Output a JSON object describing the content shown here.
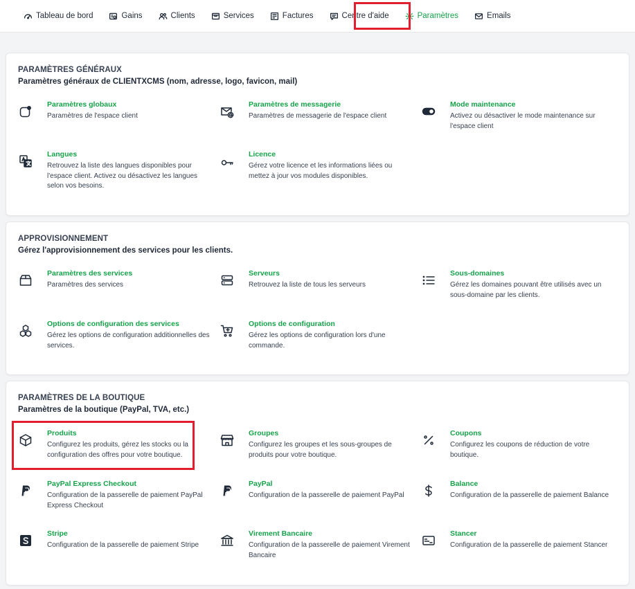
{
  "nav": {
    "items": [
      {
        "label": "Tableau de bord",
        "icon": "dashboard-icon"
      },
      {
        "label": "Gains",
        "icon": "gains-icon"
      },
      {
        "label": "Clients",
        "icon": "users-icon"
      },
      {
        "label": "Services",
        "icon": "services-icon"
      },
      {
        "label": "Factures",
        "icon": "invoice-icon"
      },
      {
        "label": "Centre d'aide",
        "icon": "help-icon"
      },
      {
        "label": "Paramètres",
        "icon": "gear-icon",
        "active": true
      },
      {
        "label": "Emails",
        "icon": "mail-icon"
      }
    ]
  },
  "colors": {
    "accent": "#16a34a",
    "highlight": "#e11d2e"
  },
  "sections": [
    {
      "title": "PARAMÈTRES GÉNÉRAUX",
      "subtitle": "Paramètres généraux de CLIENTXCMS (nom, adresse, logo, favicon, mail)",
      "items": [
        {
          "title": "Paramètres globaux",
          "desc": "Paramètres de l'espace client",
          "icon": "toggle-dot-icon"
        },
        {
          "title": "Paramètres de messagerie",
          "desc": "Paramètres de messagerie de l'espace client",
          "icon": "mail-at-icon"
        },
        {
          "title": "Mode maintenance",
          "desc": "Activez ou désactiver le mode maintenance sur l'espace client",
          "icon": "toggle-on-icon"
        },
        {
          "title": "Langues",
          "desc": "Retrouvez la liste des langues disponibles pour l'espace client. Activez ou désactivez les langues selon vos besoins.",
          "icon": "translate-icon"
        },
        {
          "title": "Licence",
          "desc": "Gérez votre licence et les informations liées ou mettez à jour vos modules disponibles.",
          "icon": "key-icon"
        }
      ]
    },
    {
      "title": "APPROVISIONNEMENT",
      "subtitle": "Gérez l'approvisionnement des services pour les clients.",
      "items": [
        {
          "title": "Paramètres des services",
          "desc": "Paramètres des services",
          "icon": "box-icon"
        },
        {
          "title": "Serveurs",
          "desc": "Retrouvez la liste de tous les serveurs",
          "icon": "server-icon"
        },
        {
          "title": "Sous-domaines",
          "desc": "Gérez les domaines pouvant être utilisés avec un sous-domaine par les clients.",
          "icon": "list-icon"
        },
        {
          "title": "Options de configuration des services",
          "desc": "Gérez les options de configuration additionnelles des services.",
          "icon": "boxes-icon"
        },
        {
          "title": "Options de configuration",
          "desc": "Gérez les options de configuration lors d'une commande.",
          "icon": "cart-plus-icon"
        }
      ]
    },
    {
      "title": "PARAMÈTRES DE LA BOUTIQUE",
      "subtitle": "Paramètres de la boutique (PayPal, TVA, etc.)",
      "items": [
        {
          "title": "Produits",
          "desc": "Configurez les produits, gérez les stocks ou la configuration des offres pour votre boutique.",
          "icon": "product-box-icon"
        },
        {
          "title": "Groupes",
          "desc": "Configurez les groupes et les sous-groupes de produits pour votre boutique.",
          "icon": "shop-icon"
        },
        {
          "title": "Coupons",
          "desc": "Configurez les coupons de réduction de votre boutique.",
          "icon": "percent-icon"
        },
        {
          "title": "PayPal Express Checkout",
          "desc": "Configuration de la passerelle de paiement PayPal Express Checkout",
          "icon": "paypal-icon"
        },
        {
          "title": "PayPal",
          "desc": "Configuration de la passerelle de paiement PayPal",
          "icon": "paypal-icon"
        },
        {
          "title": "Balance",
          "desc": "Configuration de la passerelle de paiement Balance",
          "icon": "dollar-icon"
        },
        {
          "title": "Stripe",
          "desc": "Configuration de la passerelle de paiement Stripe",
          "icon": "stripe-icon"
        },
        {
          "title": "Virement Bancaire",
          "desc": "Configuration de la passerelle de paiement Virement Bancaire",
          "icon": "bank-icon"
        },
        {
          "title": "Stancer",
          "desc": "Configuration de la passerelle de paiement Stancer",
          "icon": "card-icon"
        }
      ]
    }
  ]
}
